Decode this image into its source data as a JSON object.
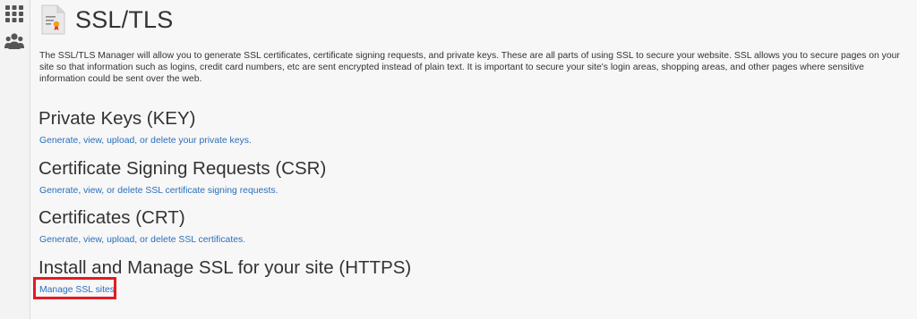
{
  "sidebar": {
    "items": [
      {
        "icon": "grid-apps-icon"
      },
      {
        "icon": "users-group-icon"
      }
    ]
  },
  "header": {
    "icon": "ssl-certificate-icon",
    "title": "SSL/TLS"
  },
  "intro": {
    "text": "The SSL/TLS Manager will allow you to generate SSL certificates, certificate signing requests, and private keys. These are all parts of using SSL to secure your website. SSL allows you to secure pages on your site so that information such as logins, credit card numbers, etc are sent encrypted instead of plain text. It is important to secure your site's login areas, shopping areas, and other pages where sensitive information could be sent over the web."
  },
  "sections": [
    {
      "heading": "Private Keys (KEY)",
      "link": "Generate, view, upload, or delete your private keys."
    },
    {
      "heading": "Certificate Signing Requests (CSR)",
      "link": "Generate, view, or delete SSL certificate signing requests."
    },
    {
      "heading": "Certificates (CRT)",
      "link": "Generate, view, upload, or delete SSL certificates."
    },
    {
      "heading": "Install and Manage SSL for your site (HTTPS)",
      "link": "Manage SSL sites."
    }
  ],
  "colors": {
    "link": "#2a6ebb",
    "highlight": "#e31b23",
    "text": "#333333"
  }
}
